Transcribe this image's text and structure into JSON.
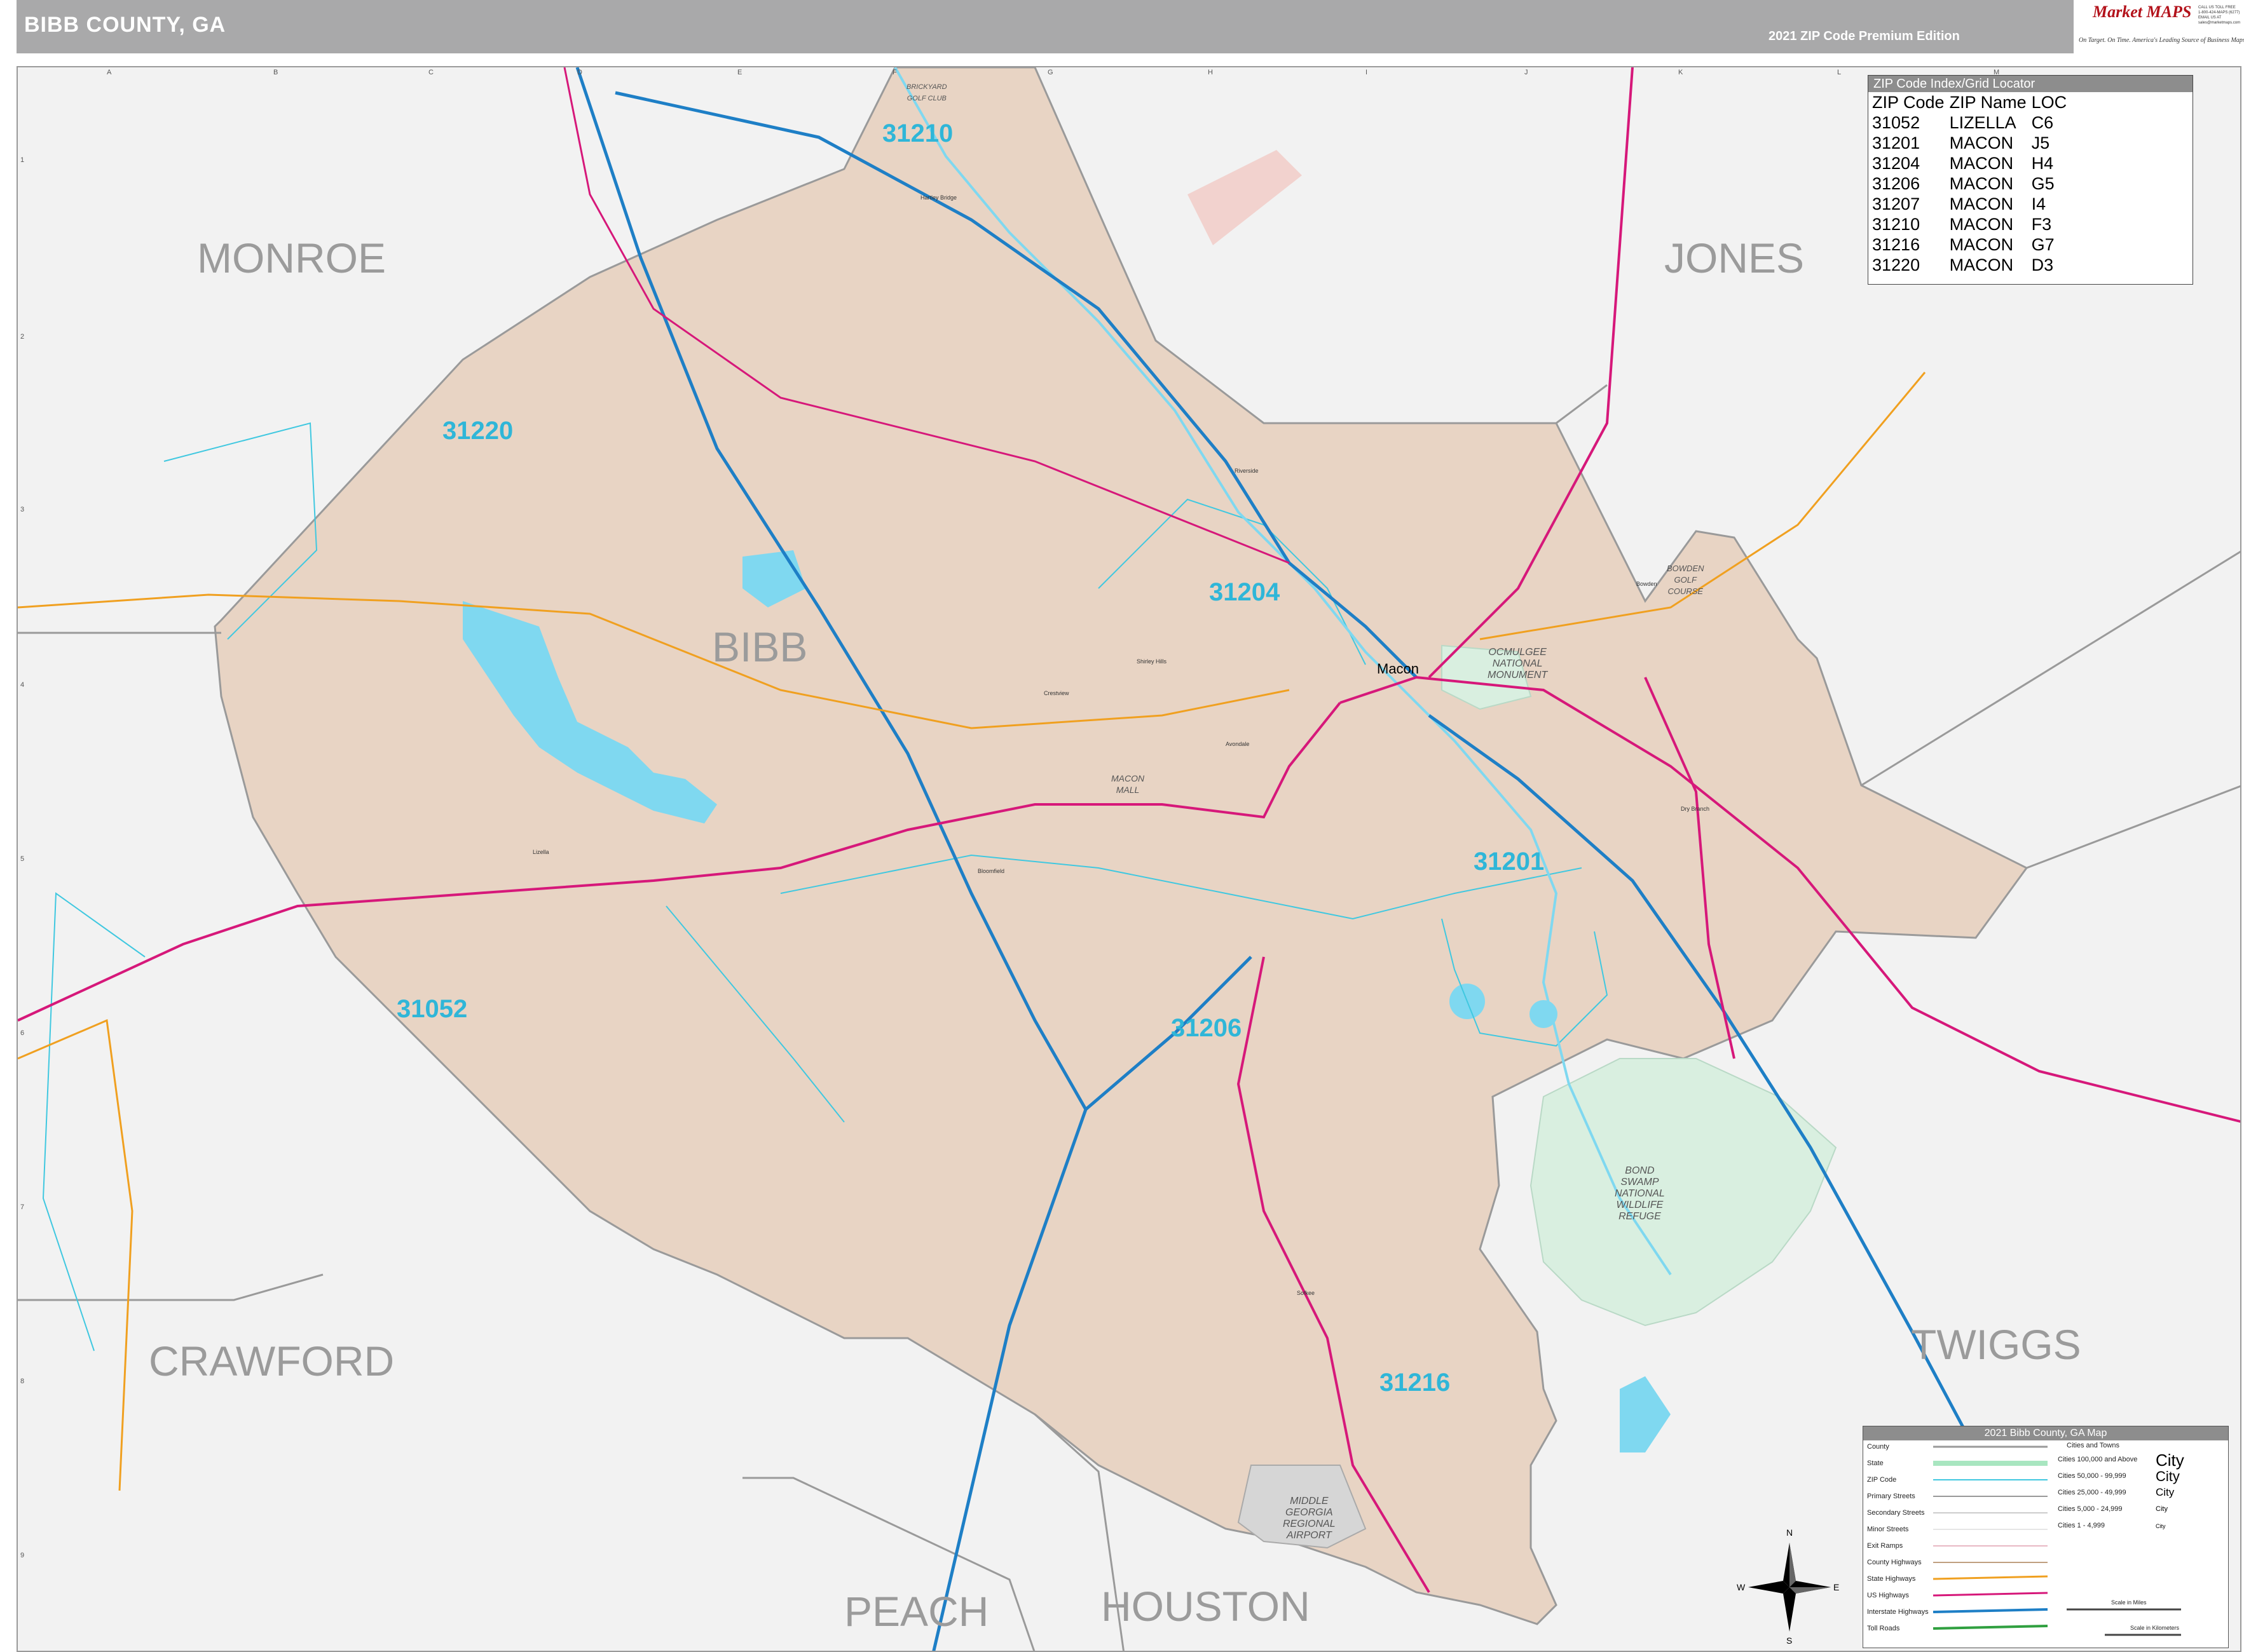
{
  "header": {
    "title": "BIBB COUNTY, GA",
    "edition": "2021 ZIP Code Premium Edition",
    "logo_brand": "Market MAPS",
    "logo_tagline": "On Target. On Time. America's Leading Source of Business Maps",
    "logo_contact": "CALL US TOLL FREE\n1-800-424-MAPS (6277)\nEMAIL US AT\nsales@marketmaps.com"
  },
  "grid": {
    "columns": [
      "A",
      "B",
      "C",
      "D",
      "E",
      "F",
      "G",
      "H",
      "I",
      "J",
      "K",
      "L",
      "M"
    ],
    "rows": [
      "1",
      "2",
      "3",
      "4",
      "5",
      "6",
      "7",
      "8",
      "9"
    ]
  },
  "counties": {
    "bibb": "BIBB",
    "monroe": "MONROE",
    "jones": "JONES",
    "crawford": "CRAWFORD",
    "twiggs": "TWIGGS",
    "peach": "PEACH",
    "houston": "HOUSTON"
  },
  "zip_labels": {
    "z31210": "31210",
    "z31220": "31220",
    "z31204": "31204",
    "z31201": "31201",
    "z31052": "31052",
    "z31206": "31206",
    "z31216": "31216"
  },
  "city": "Macon",
  "parks": {
    "ocmulgee": "OCMULGEE\nNATIONAL\nMONUMENT",
    "bond_swamp": "BOND\nSWAMP\nNATIONAL\nWILDLIFE\nREFUGE",
    "airport": "MIDDLE\nGEORGIA\nREGIONAL\nAIRPORT",
    "macon_mall": "MACON\nMALL",
    "bowden": "BOWDEN\nGOLF\nCOURSE",
    "brickyard": "BRICKYARD\nGOLF CLUB"
  },
  "places": [
    "Lizella",
    "Bloomfield",
    "Macon Mall",
    "Hartley Bridge",
    "Riverside",
    "Shirley Hills",
    "Crestview",
    "Bowden",
    "Sofkee",
    "Avondale",
    "Dry Branch"
  ],
  "zip_index": {
    "heading": "ZIP Code Index/Grid Locator",
    "columns": [
      "ZIP Code",
      "ZIP Name",
      "LOC"
    ],
    "rows": [
      [
        "31052",
        "LIZELLA",
        "C6"
      ],
      [
        "31201",
        "MACON",
        "J5"
      ],
      [
        "31204",
        "MACON",
        "H4"
      ],
      [
        "31206",
        "MACON",
        "G5"
      ],
      [
        "31207",
        "MACON",
        "I4"
      ],
      [
        "31210",
        "MACON",
        "F3"
      ],
      [
        "31216",
        "MACON",
        "G7"
      ],
      [
        "31220",
        "MACON",
        "D3"
      ]
    ]
  },
  "legend": {
    "heading": "2021 Bibb County, GA Map",
    "items": [
      "County",
      "State",
      "ZIP Code",
      "Primary Streets",
      "Secondary Streets",
      "Minor Streets",
      "Exit Ramps",
      "County Highways",
      "State Highways",
      "US Highways",
      "Interstate Highways",
      "Toll Roads"
    ],
    "cities_heading": "Cities and Towns",
    "city_classes": [
      {
        "range": "Cities 100,000 and Above",
        "sample": "City"
      },
      {
        "range": "Cities 50,000 - 99,999",
        "sample": "City"
      },
      {
        "range": "Cities 25,000 - 49,999",
        "sample": "City"
      },
      {
        "range": "Cities 5,000 - 24,999",
        "sample": "City"
      },
      {
        "range": "Cities 1 - 4,999",
        "sample": "City"
      }
    ],
    "scale_miles": "Scale in Miles",
    "scale_km": "Scale in Kilometers"
  },
  "compass": {
    "n": "N",
    "s": "S",
    "e": "E",
    "w": "W"
  },
  "colors": {
    "county_fill": "#e8d4c4",
    "background": "#f2f2f2",
    "water": "#7fd8f0",
    "park": "#d9efe0",
    "interstate": "#1e7fc6",
    "us_highway": "#d6187a",
    "state_highway": "#f0a020",
    "zip_line": "#40c8e0",
    "header": "#a9a9aa"
  }
}
